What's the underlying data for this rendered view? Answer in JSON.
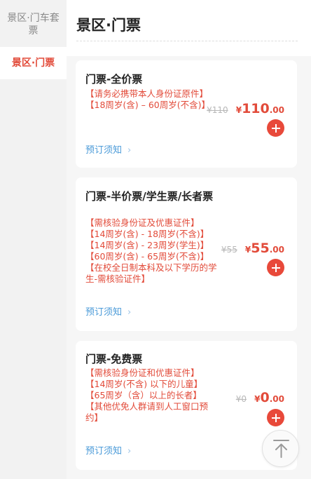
{
  "sidebar": {
    "items": [
      {
        "label": "景区·门车套票"
      },
      {
        "label": "景区·门票"
      }
    ]
  },
  "main": {
    "title": "景区·门票",
    "tickets": [
      {
        "name": "门票-全价票",
        "notes": [
          "【请务必携带本人身份证原件】",
          "【18周岁(含) – 60周岁(不含)】"
        ],
        "original_price": "¥110",
        "currency": "¥",
        "price_int": "110",
        "price_dec": ".00",
        "notice_label": "预订须知"
      },
      {
        "name": "门票-半价票/学生票/长者票",
        "notes": [
          "【需核验身份证及优惠证件】",
          "【14周岁(含) - 18周岁(不含)】",
          "【14周岁(含) - 23周岁(学生)】",
          "【60周岁(含) - 65周岁(不含)】",
          "【在校全日制本科及以下学历的学生-需核验证件】"
        ],
        "original_price": "¥55",
        "currency": "¥",
        "price_int": "55",
        "price_dec": ".00",
        "notice_label": "预订须知"
      },
      {
        "name": "门票-免费票",
        "notes": [
          "【需核验身份证和优惠证件】",
          "【14周岁(不含) 以下的儿童】",
          "【65周岁（含）以上的长者】",
          "【其他优免人群请到人工窗口预约】"
        ],
        "original_price": "¥0",
        "currency": "¥",
        "price_int": "0",
        "price_dec": ".00",
        "notice_label": "预订须知"
      }
    ]
  },
  "icons": {
    "add": "plus-circle-icon",
    "chevron": "chevron-right-icon",
    "scroll_top": "arrow-up-to-top-icon"
  }
}
